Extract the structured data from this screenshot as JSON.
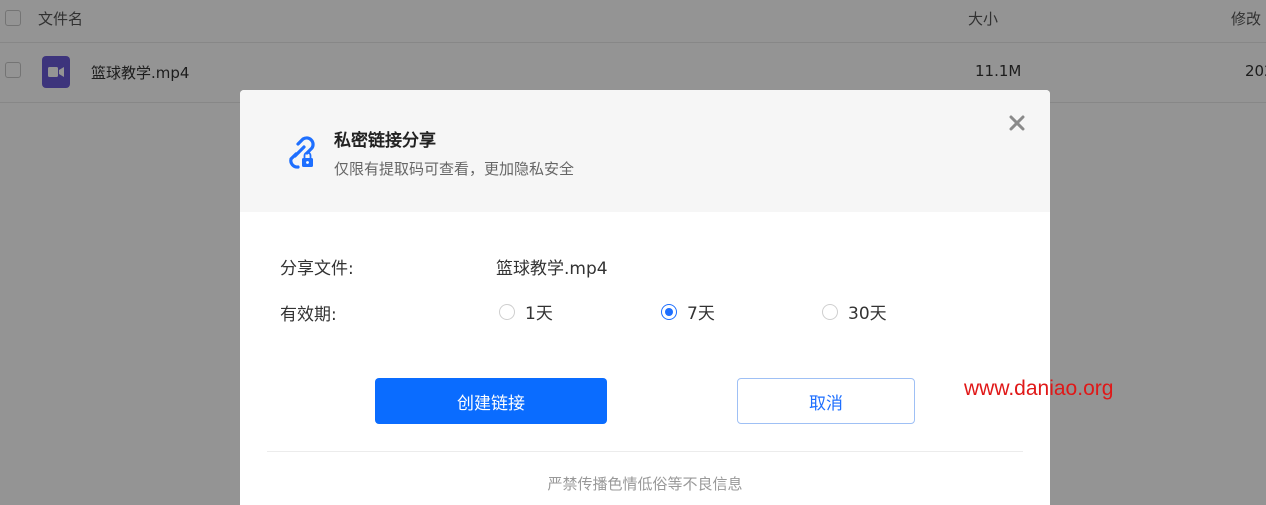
{
  "file_list": {
    "header": {
      "name_col": "文件名",
      "size_col": "大小",
      "modified_col": "修改"
    },
    "rows": [
      {
        "name": "篮球教学.mp4",
        "size": "11.1M",
        "modified": "202",
        "icon": "video-file-icon"
      }
    ]
  },
  "dialog": {
    "title": "私密链接分享",
    "subtitle": "仅限有提取码可查看，更加隐私安全",
    "icon": "private-link-icon",
    "close_icon": "close-icon",
    "share_file_label": "分享文件:",
    "share_file_value": "篮球教学.mp4",
    "validity_label": "有效期:",
    "validity_options": [
      {
        "label": "1天",
        "selected": false
      },
      {
        "label": "7天",
        "selected": true
      },
      {
        "label": "30天",
        "selected": false
      }
    ],
    "create_button": "创建链接",
    "cancel_button": "取消",
    "footer_note": "严禁传播色情低俗等不良信息"
  },
  "watermark": "www.daniao.org",
  "colors": {
    "accent": "#0a6cff",
    "cancel_border": "#9fc0f5",
    "video_icon": "#6a5bd6",
    "watermark": "#e01818"
  }
}
